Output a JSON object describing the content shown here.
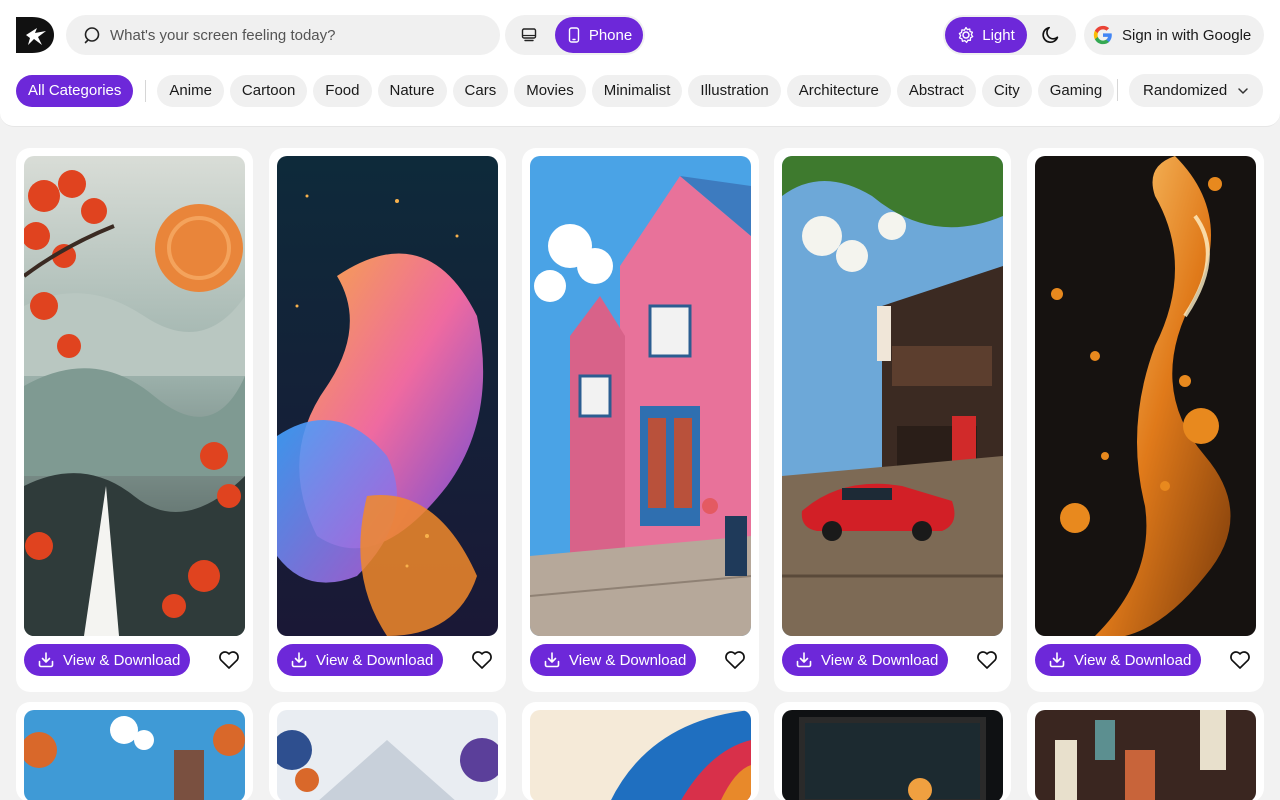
{
  "search": {
    "placeholder": "What's your screen feeling today?"
  },
  "device": {
    "desktop_icon": "monitor-icon",
    "phone_label": "Phone"
  },
  "theme": {
    "light_label": "Light",
    "dark_icon": "moon-icon"
  },
  "auth": {
    "signin_label": "Sign in with Google"
  },
  "categories": [
    "All Categories",
    "Anime",
    "Cartoon",
    "Food",
    "Nature",
    "Cars",
    "Movies",
    "Minimalist",
    "Illustration",
    "Architecture",
    "Abstract",
    "City",
    "Gaming"
  ],
  "sort": {
    "selected": "Randomized"
  },
  "cards": [
    {
      "action_label": "View & Download",
      "theme": "chinese-landscape"
    },
    {
      "action_label": "View & Download",
      "theme": "abstract-swirl"
    },
    {
      "action_label": "View & Download",
      "theme": "pink-street"
    },
    {
      "action_label": "View & Download",
      "theme": "red-car-alley"
    },
    {
      "action_label": "View & Download",
      "theme": "molten-gold"
    }
  ],
  "colors": {
    "accent": "#6d28d9",
    "surface": "#ffffff",
    "background": "#f2f2f2",
    "chip": "#f0f0f0"
  }
}
